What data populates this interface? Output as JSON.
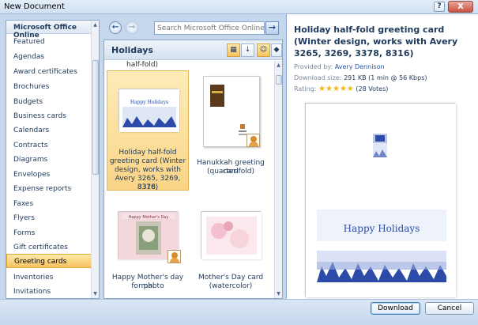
{
  "window": {
    "title": "New Document",
    "help": "?",
    "close": "X"
  },
  "categories": {
    "heading": "Microsoft Office Online",
    "items": [
      "Featured",
      "Agendas",
      "Award certificates",
      "Brochures",
      "Budgets",
      "Business cards",
      "Calendars",
      "Contracts",
      "Diagrams",
      "Envelopes",
      "Expense reports",
      "Faxes",
      "Flyers",
      "Forms",
      "Gift certificates",
      "Greeting cards",
      "Inventories",
      "Invitations"
    ],
    "selected": "Greeting cards"
  },
  "nav": {
    "back": "←",
    "forward": "→",
    "search_placeholder": "Search Microsoft Office Online for",
    "search_go": "→"
  },
  "gallery": {
    "title": "Holidays",
    "cut_label": "half-fold)",
    "tiles": [
      {
        "caption": [
          "Holiday half-fold",
          "greeting card (Winter",
          "design, works with",
          "Avery 3265, 3269, 3378,",
          "8316)"
        ],
        "card_text": "Happy Holidays"
      },
      {
        "caption": [
          "Hanukkah greeting card",
          "(quarter-fold)"
        ]
      },
      {
        "caption": [
          "Happy Mother's day mal",
          "for photo"
        ],
        "card_text": "Happy Mother's Day"
      },
      {
        "caption": [
          "Mother's Day card",
          "(watercolor)"
        ]
      }
    ]
  },
  "details": {
    "title": "Holiday half-fold greeting card (Winter design, works with Avery 3265, 3269, 3378, 8316)",
    "provided_label": "Provided by:",
    "provided_value": "Avery Dennison",
    "size_label": "Download size:",
    "size_value": "291 KB (1 min @ 56 Kbps)",
    "rating_label": "Rating:",
    "rating_stars": "★★★★★",
    "rating_votes": "(28 Votes)",
    "preview_text": "Happy Holidays"
  },
  "buttons": {
    "download": "Download",
    "cancel": "Cancel"
  },
  "colors": {
    "selected": "#f7c35f",
    "accent": "#1e395b",
    "winter_blue": "#2c4aa8"
  }
}
